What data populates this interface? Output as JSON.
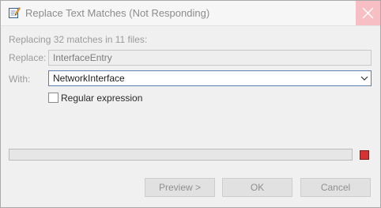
{
  "window": {
    "title": "Replace Text Matches (Not Responding)"
  },
  "summary": "Replacing 32 matches in 11 files:",
  "replace": {
    "label": "Replace:",
    "value": "InterfaceEntry"
  },
  "with": {
    "label": "With:",
    "value": "NetworkInterface"
  },
  "regex": {
    "label": "Regular expression",
    "checked": false
  },
  "progress": {
    "fraction": 0
  },
  "buttons": {
    "preview": "Preview >",
    "ok": "OK",
    "cancel": "Cancel"
  },
  "icons": {
    "app": "edit-document-icon",
    "close": "close-icon",
    "dropdown": "chevron-down-icon",
    "stop": "stop-icon"
  },
  "colors": {
    "close_bg": "#f7bfc3",
    "stop": "#d73232",
    "focus_border": "#5b7fb3"
  }
}
